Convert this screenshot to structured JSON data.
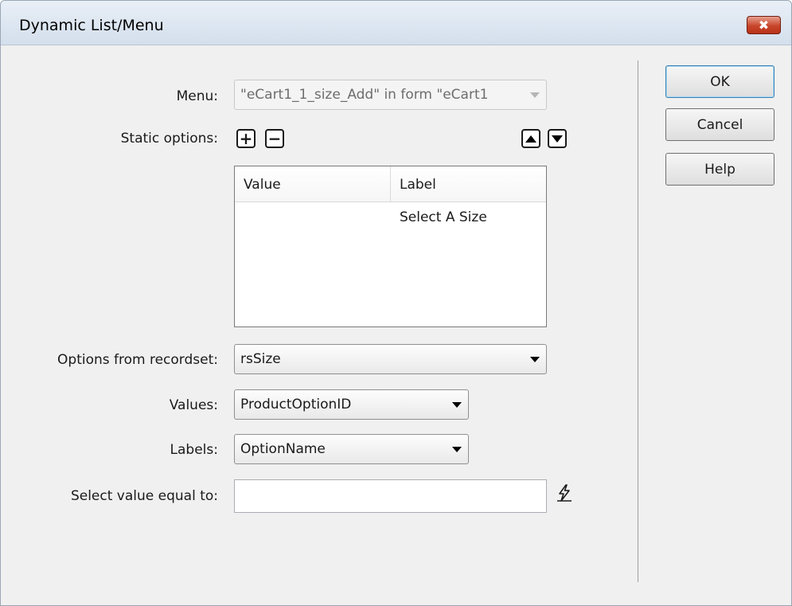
{
  "window": {
    "title": "Dynamic List/Menu",
    "close_glyph": "✖"
  },
  "form": {
    "menu_label": "Menu:",
    "menu_value": "\"eCart1_1_size_Add\" in form \"eCart1",
    "static_options_label": "Static options:",
    "add_glyph": "+",
    "remove_glyph": "−",
    "options_from_recordset_label": "Options from recordset:",
    "recordset_value": "rsSize",
    "values_label": "Values:",
    "values_value": "ProductOptionID",
    "labels_label": "Labels:",
    "labels_value": "OptionName",
    "select_value_label": "Select value equal to:",
    "select_value_value": ""
  },
  "static_options": {
    "columns": [
      "Value",
      "Label"
    ],
    "rows": [
      {
        "value": "",
        "label": "Select A Size"
      }
    ]
  },
  "buttons": {
    "ok": "OK",
    "cancel": "Cancel",
    "help": "Help"
  },
  "icons": {
    "add": "plus-icon",
    "remove": "minus-icon",
    "move_up": "triangle-up-icon",
    "move_down": "triangle-down-icon",
    "dynamic_data": "lightning-bolt-icon",
    "close": "close-icon"
  },
  "colors": {
    "close_button": "#c8452b",
    "default_button_border": "#3c7fb1"
  }
}
